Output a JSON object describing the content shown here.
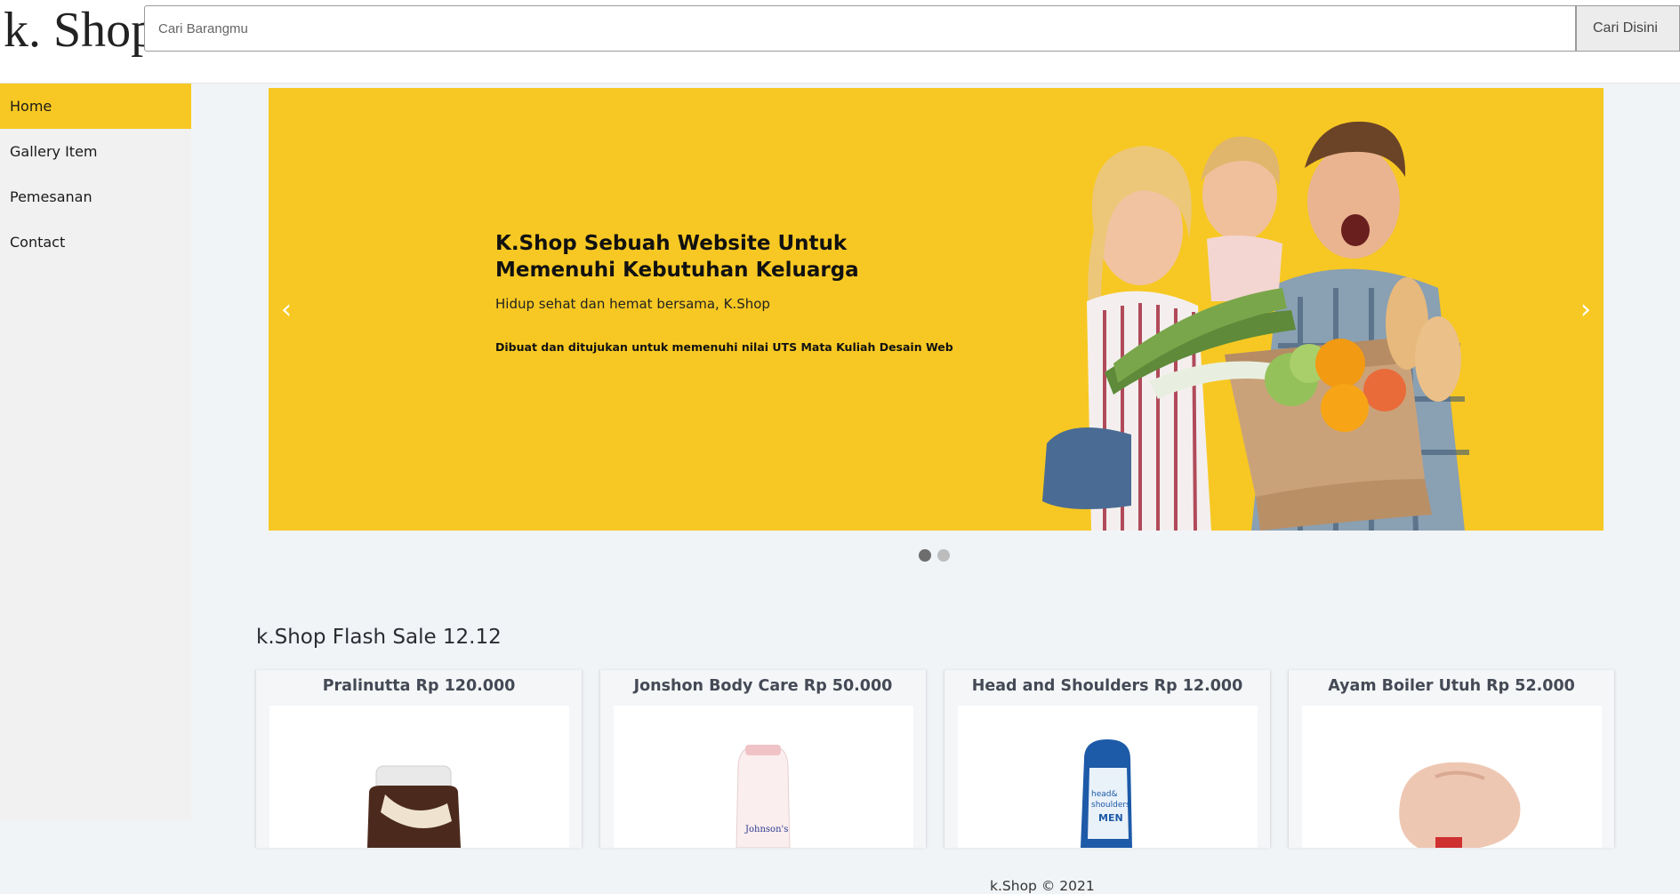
{
  "header": {
    "logo": "k. Shop",
    "search_placeholder": "Cari Barangmu",
    "search_button": "Cari Disini"
  },
  "sidebar": {
    "items": [
      {
        "label": "Home",
        "active": true
      },
      {
        "label": "Gallery Item",
        "active": false
      },
      {
        "label": "Pemesanan",
        "active": false
      },
      {
        "label": "Contact",
        "active": false
      }
    ]
  },
  "carousel": {
    "title": "K.Shop Sebuah Website Untuk Memenuhi Kebutuhan Keluarga",
    "subtitle": "Hidup sehat dan hemat bersama, K.Shop",
    "note": "Dibuat dan ditujukan untuk memenuhi nilai UTS Mata Kuliah Desain Web",
    "prev_icon": "chevron-left-icon",
    "next_icon": "chevron-right-icon",
    "active_slide": 1,
    "slide_count": 2
  },
  "flash_sale": {
    "title": "k.Shop Flash Sale 12.12",
    "products": [
      {
        "title": "Pralinutta Rp 120.000"
      },
      {
        "title": "Jonshon Body Care Rp 50.000"
      },
      {
        "title": "Head and Shoulders Rp 12.000"
      },
      {
        "title": "Ayam Boiler Utuh Rp 52.000"
      }
    ]
  },
  "footer": {
    "text": "k.Shop © 2021"
  },
  "colors": {
    "accent": "#f7c823",
    "sidebar_bg": "#f1f1f1",
    "main_bg": "#f1f4f7",
    "dot_active": "#6d6d6d",
    "dot_inactive": "#bdbdbd"
  }
}
